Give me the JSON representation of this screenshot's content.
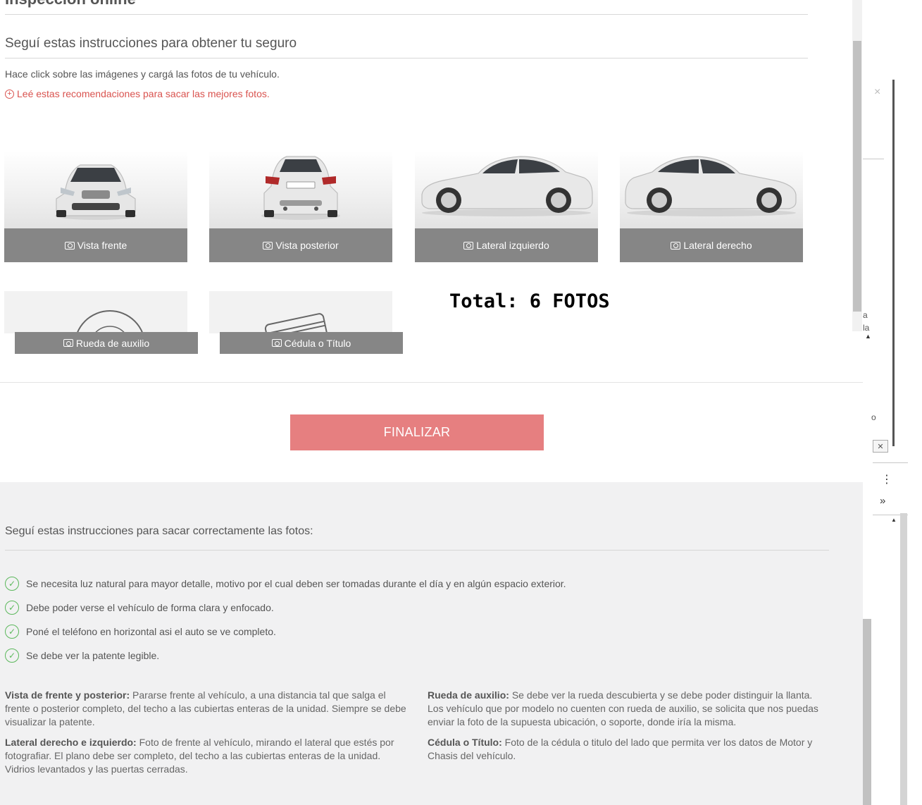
{
  "header": {
    "section_title": "Inspección online",
    "subtitle": "Seguí estas instrucciones para obtener tu seguro",
    "hint": "Hace click sobre las imágenes y cargá las fotos de tu vehículo.",
    "recommendations_link": "Leé estas recomendaciones para sacar las mejores fotos."
  },
  "photos": [
    {
      "label": "Vista frente",
      "icon": "camera-icon"
    },
    {
      "label": "Vista posterior",
      "icon": "camera-icon"
    },
    {
      "label": "Lateral izquierdo",
      "icon": "camera-icon"
    },
    {
      "label": "Lateral derecho",
      "icon": "camera-icon"
    },
    {
      "label": "Rueda de auxilio",
      "icon": "camera-icon"
    },
    {
      "label": "Cédula o Título",
      "icon": "camera-icon"
    }
  ],
  "total_label": "Total: 6 FOTOS",
  "finish_button": "FINALIZAR",
  "instructions": {
    "title": "Seguí estas instrucciones para sacar correctamente las fotos:",
    "checks": [
      "Se necesita luz natural para mayor detalle, motivo por el cual deben ser tomadas durante el día y en algún espacio exterior.",
      "Debe poder verse el vehículo de forma clara y enfocado.",
      "Poné el teléfono en horizontal asi el auto se ve completo.",
      "Se debe ver la patente legible."
    ],
    "details": [
      {
        "title": "Vista de frente y posterior:",
        "text": "Pararse frente al vehículo, a una distancia tal que salga el frente o posterior completo, del techo a las cubiertas enteras de la unidad. Siempre se debe visualizar la patente."
      },
      {
        "title": "Lateral derecho e izquierdo:",
        "text": "Foto de frente al vehículo, mirando el lateral que estés por fotografiar. El plano debe ser completo, del techo a las cubiertas enteras de la unidad. Vidrios levantados y las puertas cerradas."
      },
      {
        "title": "Rueda de auxilio:",
        "text": "Se debe ver la rueda descubierta y se debe poder distinguir la llanta. Los vehículo que por modelo no cuenten con rueda de auxilio, se solicita que nos puedas enviar la foto de la supuesta ubicación, o soporte, donde iría la misma."
      },
      {
        "title": "Cédula o Título:",
        "text": "Foto de la cédula o titulo del lado que permita ver los datos de Motor y Chasis del vehículo."
      }
    ]
  },
  "side_panel": {
    "close": "×",
    "fragment_a": "a",
    "fragment_la": "la",
    "fragment_o": "o",
    "more_vert": "⋮",
    "chevrons": "»"
  },
  "colors": {
    "accent_red": "#d9534f",
    "finish_button": "#e67f80",
    "label_gray": "#868686",
    "check_green": "#5cb85c",
    "instructions_bg": "#f1f1f2"
  }
}
